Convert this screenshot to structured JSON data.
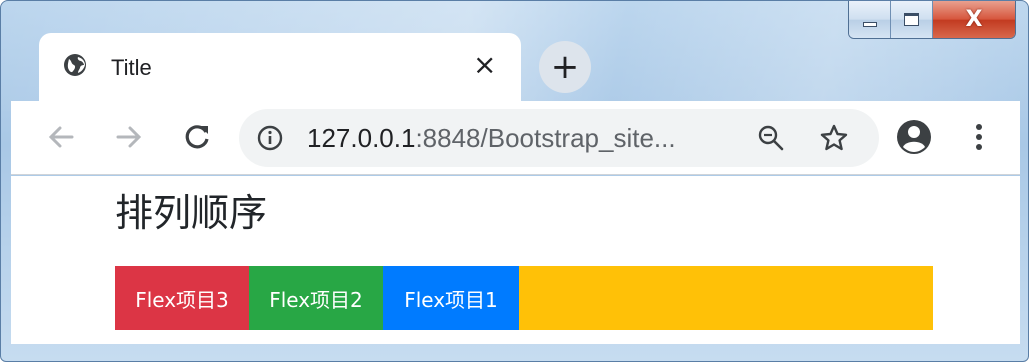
{
  "window": {
    "caption": {
      "close_glyph": "X"
    }
  },
  "tab": {
    "title": "Title",
    "close_glyph": "×",
    "favicon": "globe-icon"
  },
  "new_tab": {
    "label": "+"
  },
  "toolbar": {
    "icons": [
      "back-arrow-icon",
      "forward-arrow-icon",
      "reload-icon",
      "info-icon",
      "zoom-icon",
      "star-icon",
      "account-icon",
      "more-menu-icon"
    ],
    "url_host": "127.0.0.1",
    "url_path": ":8848/Bootstrap_site..."
  },
  "page": {
    "heading": "排列顺序",
    "flex_items": [
      {
        "label": "Flex项目3",
        "color": "#dc3545"
      },
      {
        "label": "Flex项目2",
        "color": "#28a745"
      },
      {
        "label": "Flex项目1",
        "color": "#007bff"
      }
    ],
    "container_color": "#ffc107"
  }
}
